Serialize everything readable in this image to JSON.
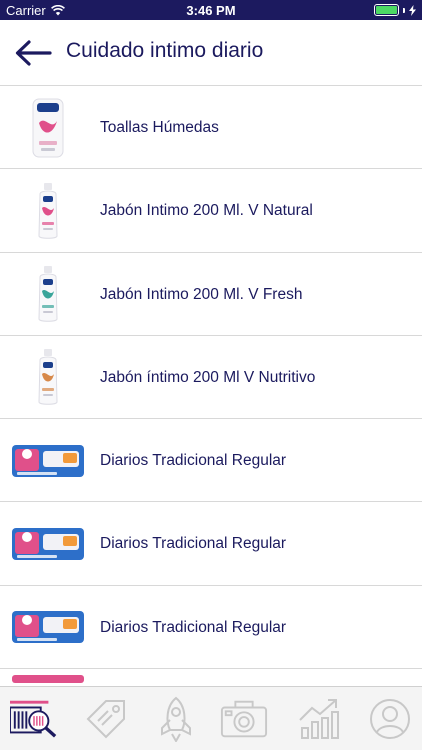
{
  "status_bar": {
    "carrier": "Carrier",
    "time": "3:46 PM",
    "battery_percent": 100
  },
  "header": {
    "title": "Cuidado intimo diario",
    "back_icon": "arrow-left-icon"
  },
  "products": [
    {
      "name": "Toallas Húmedas",
      "image": "wipes-pack",
      "accent": "#e0508a"
    },
    {
      "name": "Jabón Intimo 200 Ml. V Natural",
      "image": "soap-bottle",
      "accent": "#e0508a"
    },
    {
      "name": "Jabón Intimo 200 Ml. V Fresh",
      "image": "soap-bottle",
      "accent": "#3aa59a"
    },
    {
      "name": "Jabón íntimo 200 Ml V Nutritivo",
      "image": "soap-bottle",
      "accent": "#d7894a"
    },
    {
      "name": "Diarios Tradicional Regular",
      "image": "liners-box",
      "accent": "#2d6fc9"
    },
    {
      "name": "Diarios Tradicional Regular",
      "image": "liners-box",
      "accent": "#2d6fc9"
    },
    {
      "name": "Diarios Tradicional Regular",
      "image": "liners-box",
      "accent": "#2d6fc9"
    }
  ],
  "tab_bar": {
    "items": [
      {
        "icon": "barcode-search-icon",
        "active": true
      },
      {
        "icon": "price-tag-icon",
        "active": false
      },
      {
        "icon": "rocket-icon",
        "active": false
      },
      {
        "icon": "camera-icon",
        "active": false
      },
      {
        "icon": "growth-chart-icon",
        "active": false
      },
      {
        "icon": "user-profile-icon",
        "active": false
      }
    ]
  },
  "colors": {
    "brand": "#1c1a5f",
    "divider": "#d8d8d8",
    "accent": "#e0508a"
  }
}
